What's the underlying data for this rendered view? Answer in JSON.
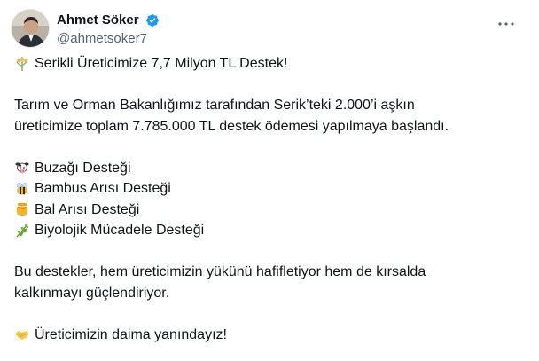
{
  "user": {
    "display_name": "Ahmet Söker",
    "handle": "@ahmetsoker7",
    "verified": true
  },
  "icons": {
    "verified": "verified-badge-icon",
    "more": "more-options-icon",
    "headline_emoji": "sheaf-of-rice-emoji",
    "item_emojis": [
      "cow-emoji",
      "bee-emoji",
      "honey-pot-emoji",
      "herb-emoji"
    ],
    "closing_emoji": "handshake-emoji"
  },
  "colors": {
    "verified": "#1d9bf0",
    "text": "#0f1419",
    "secondary_text": "#536471"
  },
  "tweet": {
    "headline": "Serikli Üreticimize 7,7 Milyon TL Destek!",
    "paragraph_lines": [
      "Tarım ve Orman Bakanlığımız tarafından Serik’teki 2.000’i aşkın",
      "üreticimize toplam 7.785.000 TL destek ödemesi yapılmaya başlandı."
    ],
    "items": [
      "Buzağı Desteği",
      "Bambus Arısı Desteği",
      "Bal Arısı Desteği",
      "Biyolojik Mücadele Desteği"
    ],
    "closing_lines": [
      "Bu destekler, hem üreticimizin yükünü hafifletiyor hem de kırsalda",
      "kalkınmayı güçlendiriyor."
    ],
    "sign_off": "Üreticimizin daima yanındayız!"
  }
}
